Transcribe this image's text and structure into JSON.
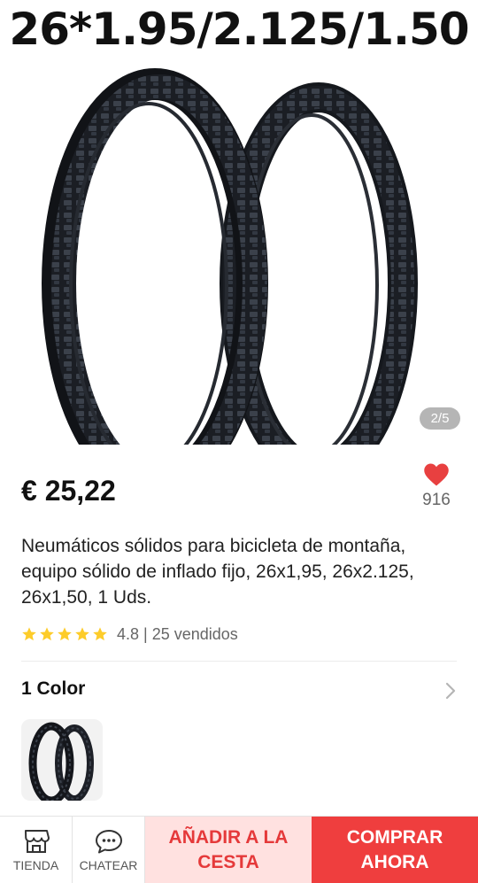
{
  "product": {
    "image_caption": "26*1.95/2.125/1.50",
    "image_counter": "2/5",
    "price": "€ 25,22",
    "wishlist_count": "916",
    "title": "Neumáticos sólidos para bicicleta de montaña, equipo sólido de inflado fijo, 26x1,95, 26x2.125, 26x1,50, 1 Uds.",
    "rating_value": 4.8,
    "rating_text": "4.8 | 25 vendidos",
    "stars": 5
  },
  "variants": {
    "label": "1 Color"
  },
  "bottom_bar": {
    "store_label": "TIENDA",
    "chat_label": "CHATEAR",
    "add_to_cart_label": "AÑADIR A LA CESTA",
    "buy_now_label": "COMPRAR AHORA"
  },
  "colors": {
    "accent_red": "#ef3e3e",
    "heart_red": "#e84040",
    "cart_bg": "#ffe1e0",
    "star_yellow": "#fdcc2a"
  },
  "icons": {
    "wishlist": "heart-icon",
    "store": "store-icon",
    "chat": "chat-bubble-icon",
    "more": "chevron-right-icon",
    "rating": "star-icon"
  }
}
